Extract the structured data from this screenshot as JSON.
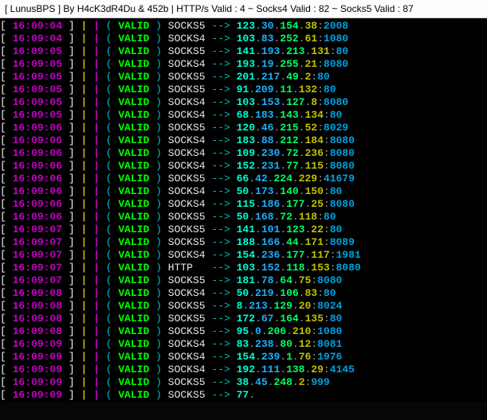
{
  "title": "[ LunusBPS ] By H4cK3dR4Du & 452b | HTTP/s Valid : 4 ~ Socks4 Valid : 82 ~ Socks5 Valid : 87",
  "rows": [
    {
      "ts": "16:09:04",
      "prot": "SOCKS5",
      "a": "123",
      "b": "30",
      "c": "154",
      "d": "38",
      "p": "2008"
    },
    {
      "ts": "16:09:04",
      "prot": "SOCKS4",
      "a": "103",
      "b": "83",
      "c": "252",
      "d": "61",
      "p": "1080"
    },
    {
      "ts": "16:09:05",
      "prot": "SOCKS5",
      "a": "141",
      "b": "193",
      "c": "213",
      "d": "131",
      "p": "80"
    },
    {
      "ts": "16:09:05",
      "prot": "SOCKS4",
      "a": "193",
      "b": "19",
      "c": "255",
      "d": "21",
      "p": "8080"
    },
    {
      "ts": "16:09:05",
      "prot": "SOCKS5",
      "a": "201",
      "b": "217",
      "c": "49",
      "d": "2",
      "p": "80"
    },
    {
      "ts": "16:09:05",
      "prot": "SOCKS5",
      "a": "91",
      "b": "209",
      "c": "11",
      "d": "132",
      "p": "80"
    },
    {
      "ts": "16:09:05",
      "prot": "SOCKS4",
      "a": "103",
      "b": "153",
      "c": "127",
      "d": "8",
      "p": "8080"
    },
    {
      "ts": "16:09:05",
      "prot": "SOCKS4",
      "a": "68",
      "b": "183",
      "c": "143",
      "d": "134",
      "p": "80"
    },
    {
      "ts": "16:09:06",
      "prot": "SOCKS5",
      "a": "120",
      "b": "46",
      "c": "215",
      "d": "52",
      "p": "8029"
    },
    {
      "ts": "16:09:06",
      "prot": "SOCKS4",
      "a": "183",
      "b": "88",
      "c": "212",
      "d": "184",
      "p": "8080"
    },
    {
      "ts": "16:09:06",
      "prot": "SOCKS4",
      "a": "109",
      "b": "230",
      "c": "72",
      "d": "236",
      "p": "8080"
    },
    {
      "ts": "16:09:06",
      "prot": "SOCKS4",
      "a": "152",
      "b": "231",
      "c": "77",
      "d": "115",
      "p": "8080"
    },
    {
      "ts": "16:09:06",
      "prot": "SOCKS5",
      "a": "66",
      "b": "42",
      "c": "224",
      "d": "229",
      "p": "41679"
    },
    {
      "ts": "16:09:06",
      "prot": "SOCKS4",
      "a": "50",
      "b": "173",
      "c": "140",
      "d": "150",
      "p": "80"
    },
    {
      "ts": "16:09:06",
      "prot": "SOCKS4",
      "a": "115",
      "b": "186",
      "c": "177",
      "d": "25",
      "p": "8080"
    },
    {
      "ts": "16:09:06",
      "prot": "SOCKS5",
      "a": "50",
      "b": "168",
      "c": "72",
      "d": "118",
      "p": "80"
    },
    {
      "ts": "16:09:07",
      "prot": "SOCKS5",
      "a": "141",
      "b": "101",
      "c": "123",
      "d": "22",
      "p": "80"
    },
    {
      "ts": "16:09:07",
      "prot": "SOCKS5",
      "a": "188",
      "b": "166",
      "c": "44",
      "d": "171",
      "p": "8089"
    },
    {
      "ts": "16:09:07",
      "prot": "SOCKS4",
      "a": "154",
      "b": "236",
      "c": "177",
      "d": "117",
      "p": "1981"
    },
    {
      "ts": "16:09:07",
      "prot": "HTTP  ",
      "a": "103",
      "b": "152",
      "c": "118",
      "d": "153",
      "p": "8080"
    },
    {
      "ts": "16:09:07",
      "prot": "SOCKS5",
      "a": "181",
      "b": "78",
      "c": "64",
      "d": "75",
      "p": "8080"
    },
    {
      "ts": "16:09:08",
      "prot": "SOCKS4",
      "a": "50",
      "b": "219",
      "c": "106",
      "d": "83",
      "p": "80"
    },
    {
      "ts": "16:09:08",
      "prot": "SOCKS5",
      "a": "8",
      "b": "213",
      "c": "129",
      "d": "20",
      "p": "8024"
    },
    {
      "ts": "16:09:08",
      "prot": "SOCKS5",
      "a": "172",
      "b": "67",
      "c": "164",
      "d": "135",
      "p": "80"
    },
    {
      "ts": "16:09:08",
      "prot": "SOCKS5",
      "a": "95",
      "b": "0",
      "c": "206",
      "d": "210",
      "p": "1080"
    },
    {
      "ts": "16:09:09",
      "prot": "SOCKS4",
      "a": "83",
      "b": "238",
      "c": "80",
      "d": "12",
      "p": "8081"
    },
    {
      "ts": "16:09:09",
      "prot": "SOCKS4",
      "a": "154",
      "b": "239",
      "c": "1",
      "d": "76",
      "p": "1976"
    },
    {
      "ts": "16:09:09",
      "prot": "SOCKS4",
      "a": "192",
      "b": "111",
      "c": "138",
      "d": "29",
      "p": "4145"
    },
    {
      "ts": "16:09:09",
      "prot": "SOCKS5",
      "a": "38",
      "b": "45",
      "c": "248",
      "d": "2",
      "p": "999"
    },
    {
      "ts": "16:09:09",
      "prot": "SOCKS5",
      "a": "77",
      "b": "",
      "c": "",
      "d": "",
      "p": "",
      "partial": true
    }
  ]
}
